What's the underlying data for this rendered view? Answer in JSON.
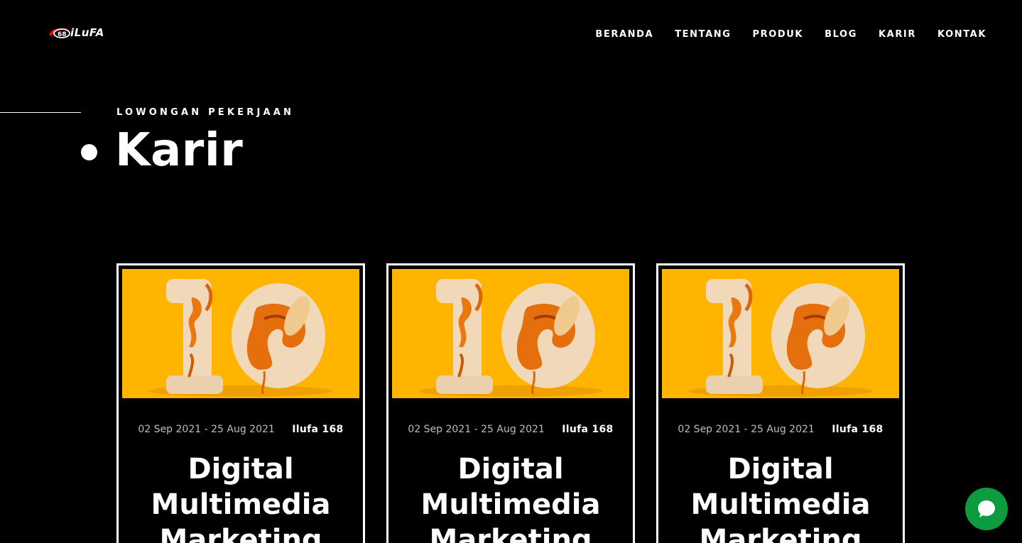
{
  "header": {
    "logo_badge": "68",
    "logo_text": "iLuFA",
    "nav": [
      "BERANDA",
      "TENTANG",
      "PRODUK",
      "BLOG",
      "KARIR",
      "KONTAK"
    ]
  },
  "hero": {
    "eyebrow": "LOWONGAN PEKERJAAN",
    "title": "Karir"
  },
  "cards": [
    {
      "date": "02 Sep 2021 - 25 Aug 2021",
      "author": "Ilufa 168",
      "title": "Digital Multimedia Marketing"
    },
    {
      "date": "02 Sep 2021 - 25 Aug 2021",
      "author": "Ilufa 168",
      "title": "Digital Multimedia Marketing"
    },
    {
      "date": "02 Sep 2021 - 25 Aug 2021",
      "author": "Ilufa 168",
      "title": "Digital Multimedia Marketing"
    }
  ],
  "colors": {
    "background": "#000000",
    "text": "#ffffff",
    "card_image_bg": "#ffb400",
    "chat_button": "#0c9b3e"
  },
  "icons": {
    "chat": "chat-bubble-icon",
    "logo": "ilufa-logo"
  }
}
